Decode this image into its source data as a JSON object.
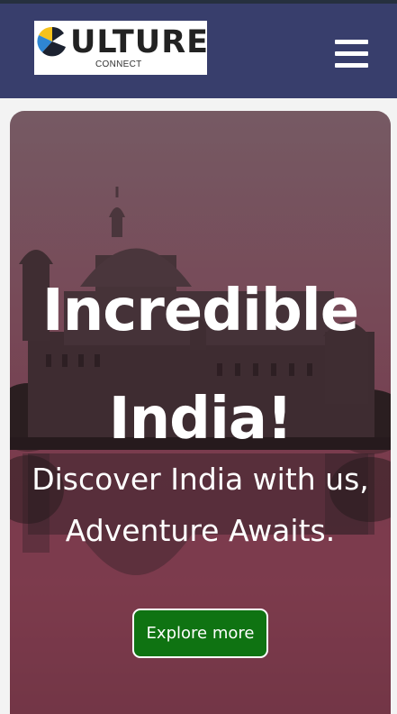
{
  "header": {
    "logo": {
      "word": "ULTURE",
      "sub": "CONNECT",
      "colors": {
        "yellow": "#f6c21b",
        "blue": "#2f86d2",
        "dark": "#1c2230"
      }
    },
    "menu_icon": "hamburger-icon",
    "background": "#383e6c"
  },
  "hero": {
    "title": "Incredible India!",
    "subtitle": "Discover India with us, Adventure Awaits.",
    "button_label": "Explore more",
    "button_color": "#0f7312"
  }
}
